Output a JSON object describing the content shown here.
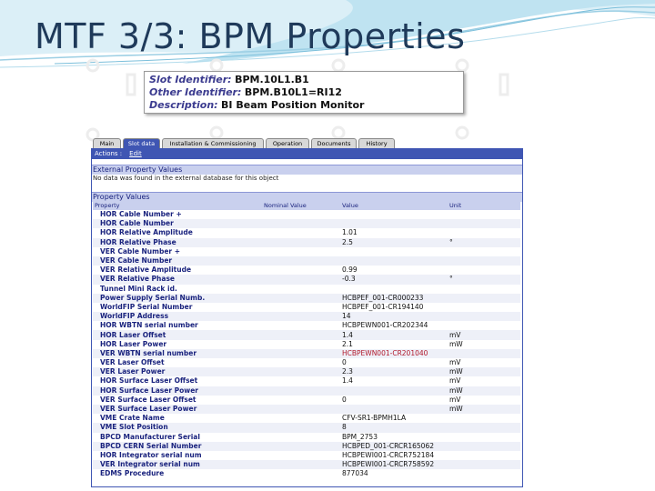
{
  "slide": {
    "title": "MTF 3/3: BPM Properties"
  },
  "identity": [
    {
      "label": "Slot Identifier:",
      "value": "BPM.10L1.B1"
    },
    {
      "label": "Other Identifier:",
      "value": "BPM.B10L1=RI12"
    },
    {
      "label": "Description:",
      "value": "BI Beam Position Monitor"
    }
  ],
  "tabs": [
    "Main",
    "Slot data",
    "Installation & Commissioning",
    "Operation",
    "Documents",
    "History"
  ],
  "active_tab": "Slot data",
  "actions": {
    "label": "Actions :",
    "edit": "Edit"
  },
  "external": {
    "title": "External Property Values",
    "note": "No data was found in the external database for this object"
  },
  "properties": {
    "title": "Property Values",
    "headers": [
      "Property",
      "Nominal Value",
      "Value",
      "Unit"
    ],
    "rows": [
      {
        "name": "HOR Cable Number +",
        "value": "",
        "unit": ""
      },
      {
        "name": "HOR Cable Number",
        "value": "",
        "unit": ""
      },
      {
        "name": "HOR Relative Amplitude",
        "value": "1.01",
        "unit": ""
      },
      {
        "name": "HOR Relative Phase",
        "value": "2.5",
        "unit": "°"
      },
      {
        "name": "VER Cable Number +",
        "value": "",
        "unit": ""
      },
      {
        "name": "VER Cable Number",
        "value": "",
        "unit": ""
      },
      {
        "name": "VER Relative Amplitude",
        "value": "0.99",
        "unit": ""
      },
      {
        "name": "VER Relative Phase",
        "value": "-0.3",
        "unit": "°"
      },
      {
        "name": "Tunnel Mini Rack id.",
        "value": "",
        "unit": ""
      },
      {
        "name": "Power Supply Serial Numb.",
        "value": "HCBPEF_001-CR000233",
        "unit": ""
      },
      {
        "name": "WorldFIP Serial Number",
        "value": "HCBPEF_001-CR194140",
        "unit": ""
      },
      {
        "name": "WorldFIP Address",
        "value": "14",
        "unit": ""
      },
      {
        "name": "HOR WBTN serial number",
        "value": "HCBPEWN001-CR202344",
        "unit": ""
      },
      {
        "name": "HOR Laser Offset",
        "value": "1.4",
        "unit": "mV"
      },
      {
        "name": "HOR Laser Power",
        "value": "2.1",
        "unit": "mW"
      },
      {
        "name": "VER WBTN serial number",
        "value": "HCBPEWN001-CR201040",
        "unit": "",
        "red": true
      },
      {
        "name": "VER Laser Offset",
        "value": "0",
        "unit": "mV"
      },
      {
        "name": "VER Laser Power",
        "value": "2.3",
        "unit": "mW"
      },
      {
        "name": "HOR Surface Laser Offset",
        "value": "1.4",
        "unit": "mV"
      },
      {
        "name": "HOR Surface Laser Power",
        "value": "",
        "unit": "mW"
      },
      {
        "name": "VER Surface Laser Offset",
        "value": "0",
        "unit": "mV"
      },
      {
        "name": "VER Surface Laser Power",
        "value": "",
        "unit": "mW"
      },
      {
        "name": "VME Crate Name",
        "value": "CFV-SR1-BPMH1LA",
        "unit": ""
      },
      {
        "name": "VME Slot Position",
        "value": "8",
        "unit": ""
      },
      {
        "name": "BPCD Manufacturer Serial",
        "value": "BPM_2753",
        "unit": ""
      },
      {
        "name": "BPCD CERN Serial Number",
        "value": "HCBPED_001-CRCR165062",
        "unit": ""
      },
      {
        "name": "HOR Integrator serial num",
        "value": "HCBPEWI001-CRCR752184",
        "unit": ""
      },
      {
        "name": "VER Integrator serial num",
        "value": "HCBPEWI001-CRCR758592",
        "unit": ""
      },
      {
        "name": "EDMS Procedure",
        "value": "877034",
        "unit": ""
      }
    ]
  }
}
